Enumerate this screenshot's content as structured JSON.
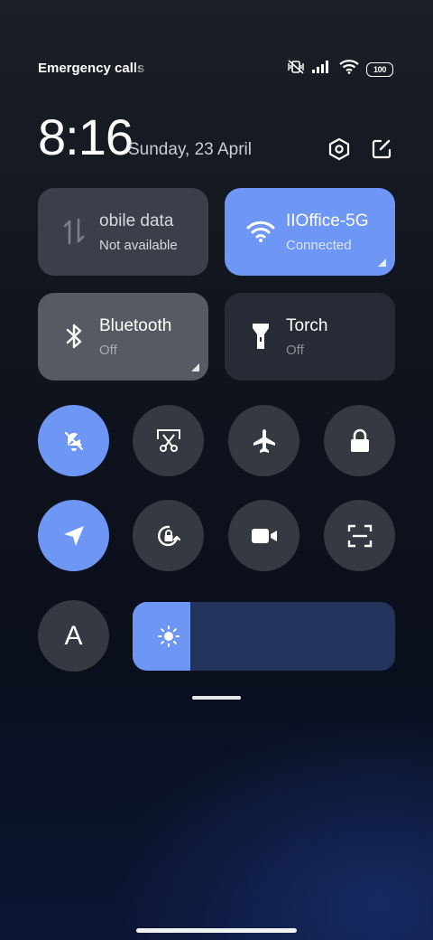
{
  "status_bar": {
    "carrier_text": "Emergency calls o",
    "battery": "100",
    "icons": [
      "mute-vibrate-icon",
      "signal-icon",
      "wifi-icon",
      "battery-icon"
    ]
  },
  "header": {
    "time": "8:16",
    "date": "Sunday, 23 April",
    "settings_icon": "settings-hexagon-icon",
    "edit_icon": "edit-icon"
  },
  "tiles": {
    "mobile_data": {
      "title": "obile data",
      "status": "Not available",
      "icon": "mobile-data-arrows-icon"
    },
    "wifi": {
      "title": "IIOffice-5G",
      "status": "Connected",
      "icon": "wifi-icon"
    },
    "bluetooth": {
      "title": "Bluetooth",
      "status": "Off",
      "icon": "bluetooth-icon"
    },
    "torch": {
      "title": "Torch",
      "status": "Off",
      "icon": "torch-icon"
    }
  },
  "toggles_row1": [
    {
      "name": "silent",
      "icon": "bell-off-icon",
      "active": true
    },
    {
      "name": "screenshot",
      "icon": "scissors-screenshot-icon",
      "active": false
    },
    {
      "name": "airplane",
      "icon": "airplane-icon",
      "active": false
    },
    {
      "name": "lock-screen",
      "icon": "lock-icon",
      "active": false
    }
  ],
  "toggles_row2": [
    {
      "name": "location",
      "icon": "location-arrow-icon",
      "active": true
    },
    {
      "name": "rotation-lock",
      "icon": "rotation-lock-icon",
      "active": false
    },
    {
      "name": "screen-recorder",
      "icon": "video-camera-icon",
      "active": false
    },
    {
      "name": "scanner",
      "icon": "scan-frame-icon",
      "active": false
    }
  ],
  "auto_brightness": {
    "label": "A"
  },
  "brightness": {
    "level": 0.22,
    "icon": "sun-icon"
  },
  "colors": {
    "accent": "#6e96f5",
    "tile_dark": "#262b35",
    "circle_off": "#343942",
    "slider_track": "#23335c"
  }
}
